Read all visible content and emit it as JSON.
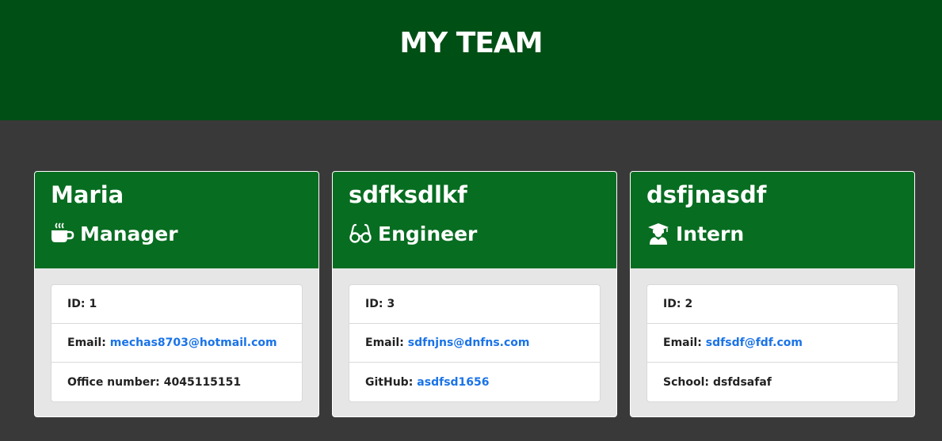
{
  "header": {
    "title": "MY TEAM"
  },
  "colors": {
    "banner": "#004f15",
    "card_header": "#076d21",
    "link": "#1a73e8",
    "background": "#393939"
  },
  "cards": [
    {
      "name": "Maria",
      "role": "Manager",
      "role_icon": "coffee-icon",
      "id_label": "ID:",
      "id": "1",
      "email_label": "Email:",
      "email": "mechas8703@hotmail.com",
      "extra_label": "Office number:",
      "extra": "4045115151"
    },
    {
      "name": "sdfksdlkf",
      "role": "Engineer",
      "role_icon": "glasses-icon",
      "id_label": "ID:",
      "id": "3",
      "email_label": "Email:",
      "email": "sdfnjns@dnfns.com",
      "extra_label": "GitHub:",
      "extra": "asdfsd1656"
    },
    {
      "name": "dsfjnasdf",
      "role": "Intern",
      "role_icon": "graduate-icon",
      "id_label": "ID:",
      "id": "2",
      "email_label": "Email:",
      "email": "sdfsdf@fdf.com",
      "extra_label": "School:",
      "extra": "dsfdsafaf"
    }
  ]
}
